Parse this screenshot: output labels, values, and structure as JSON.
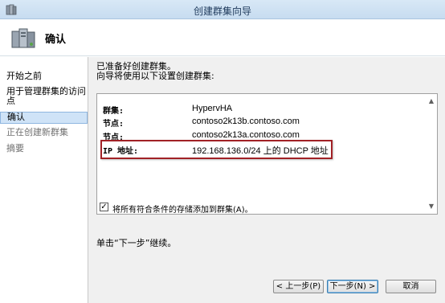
{
  "window": {
    "title": "创建群集向导"
  },
  "header": {
    "page_title": "确认"
  },
  "nav": {
    "items": [
      {
        "label": "开始之前",
        "state": "normal"
      },
      {
        "label": "用于管理群集的访问点",
        "state": "normal"
      },
      {
        "label": "确认",
        "state": "selected"
      },
      {
        "label": "正在创建新群集",
        "state": "disabled"
      },
      {
        "label": "摘要",
        "state": "disabled"
      }
    ]
  },
  "content": {
    "intro_line1": "已准备好创建群集。",
    "intro_line2": "向导将使用以下设置创建群集:",
    "summary": [
      {
        "key": "群集:",
        "value": "HypervHA"
      },
      {
        "key": "节点:",
        "value": "contoso2k13b.contoso.com"
      },
      {
        "key": "节点:",
        "value": "contoso2k13a.contoso.com"
      },
      {
        "key": "IP 地址:",
        "value": "192.168.136.0/24 上的 DHCP 地址"
      }
    ],
    "checkbox": {
      "label": "将所有符合条件的存储添加到群集(A)。",
      "checked": true,
      "mark": "✓"
    },
    "next_hint": "单击“下一步”继续。"
  },
  "buttons": {
    "prev": "< 上一步(P)",
    "next": "下一步(N) >",
    "cancel": "取消"
  },
  "colors": {
    "selected_nav": "#cfe3f7",
    "highlight_box": "#a12126",
    "titlebar": "#c7dcf0"
  }
}
